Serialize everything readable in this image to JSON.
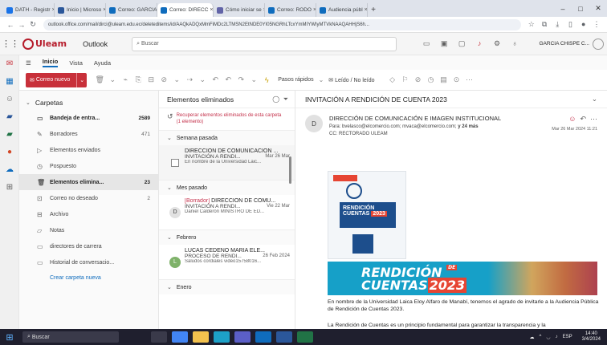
{
  "browser": {
    "tabs": [
      {
        "label": "DATH - Registr",
        "color": "#1a73e8"
      },
      {
        "label": "Inicio | Microso",
        "color": "#2b579a"
      },
      {
        "label": "Correo: GARCIA",
        "color": "#0f6cbd"
      },
      {
        "label": "Correo: DIRECC",
        "color": "#0f6cbd"
      },
      {
        "label": "Cómo iniciar se",
        "color": "#6264a7"
      },
      {
        "label": "Correo: RODO",
        "color": "#0f6cbd"
      },
      {
        "label": "Audiencia públ",
        "color": "#0f6cbd"
      }
    ],
    "url": "outlook.office.com/mail/dirci@uleam.edu.ec/deleteditems/id/AAQkADQxMmFiMDc2LTMSN2EtNDE0YI05NGRhLTcxYmMIYWIyMTVkNAAQAHHjS6h..."
  },
  "outlook": {
    "logo": "Uleam",
    "app_name": "Outlook",
    "search_placeholder": "Buscar",
    "user": "GARCIA CHISPE C..."
  },
  "ribbon": {
    "tabs": [
      "Inicio",
      "Vista",
      "Ayuda"
    ],
    "new_mail": "Correo nuevo",
    "quick_steps": "Pasos rápidos",
    "read_unread": "Leído / No leído"
  },
  "folders": {
    "header": "Carpetas",
    "items": [
      {
        "label": "Bandeja de entra...",
        "count": "2589",
        "icon": "inbox-icon",
        "bold": true
      },
      {
        "label": "Borradores",
        "count": "471",
        "icon": "pencil-icon",
        "bold": false
      },
      {
        "label": "Elementos enviados",
        "count": "",
        "icon": "send-icon",
        "bold": false
      },
      {
        "label": "Pospuesto",
        "count": "",
        "icon": "clock-icon",
        "bold": false
      },
      {
        "label": "Elementos elimina...",
        "count": "23",
        "icon": "trash-icon",
        "bold": true,
        "selected": true
      },
      {
        "label": "Correo no deseado",
        "count": "2",
        "icon": "junk-icon",
        "bold": false
      },
      {
        "label": "Archivo",
        "count": "",
        "icon": "archive-icon",
        "bold": false
      },
      {
        "label": "Notas",
        "count": "",
        "icon": "note-icon",
        "bold": false
      },
      {
        "label": "directores de carrera",
        "count": "",
        "icon": "folder-icon",
        "bold": false
      },
      {
        "label": "Historial de conversacio...",
        "count": "",
        "icon": "folder-icon",
        "bold": false
      }
    ],
    "new_folder": "Crear carpeta nueva"
  },
  "list": {
    "title": "Elementos eliminados",
    "recover": "Recuperar elementos eliminados de esta carpeta (1 elemento)",
    "groups": [
      {
        "label": "Semana pasada",
        "messages": [
          {
            "from": "DIRECCIÓN DE COMUNICACIÓN ...",
            "subject": "INVITACIÓN A RENDI...",
            "date": "Mar 26 Mar",
            "preview": "En nombre de la Universidad Laic...",
            "lead": "checkbox",
            "draft": ""
          }
        ]
      },
      {
        "label": "Mes pasado",
        "messages": [
          {
            "from": "DIRECCIÓN DE COMU...",
            "subject": "INVITACIÓN A RENDI...",
            "date": "Vie 22 Mar",
            "preview": "Daniel Calderón MINISTRO DE ED...",
            "lead": "D",
            "draft": "[Borrador]"
          }
        ]
      },
      {
        "label": "Febrero",
        "messages": [
          {
            "from": "LUCAS CEDEÑO MARIA ELE...",
            "subject": "PROCESO DE RENDI...",
            "date": "26 Feb 2024",
            "preview": "Saludos cordiales video15758016...",
            "lead": "L",
            "draft": ""
          }
        ]
      },
      {
        "label": "Enero",
        "messages": []
      }
    ]
  },
  "reading": {
    "title": "INVITACIÓN A RENDICIÓN DE CUENTA 2023",
    "avatar": "D",
    "sender": "DIRECCIÓN DE COMUNICACIÓN E IMAGEN INSTITUCIONAL",
    "to_prefix": "Para:",
    "to": "bvelasco@elcomercio.com; mvaca@elcomercio.com;",
    "to_more": "y 24 más",
    "cc": "CC: RECTORADO ULEAM",
    "date": "Mar 26 Mar 2024 11:21",
    "banner_line1": "RENDICIÓN",
    "banner_de": "DE",
    "banner_line2": "CUENTAS",
    "banner_year": "2023",
    "poster_line1": "RENDICIÓN",
    "poster_line2": "CUENTAS",
    "poster_year": "2023",
    "body1": "En nombre de la Universidad Laica Eloy Alfaro de Manabí, tenemos el agrado de invitarle a la Audiencia Pública de Rendición de Cuentas 2023.",
    "body2": "La Rendición de Cuentas es un principio fundamental para garantizar la transparencia y la"
  },
  "taskbar": {
    "search": "Buscar",
    "lang": "ESP",
    "time": "14:40",
    "date": "3/4/2024"
  }
}
